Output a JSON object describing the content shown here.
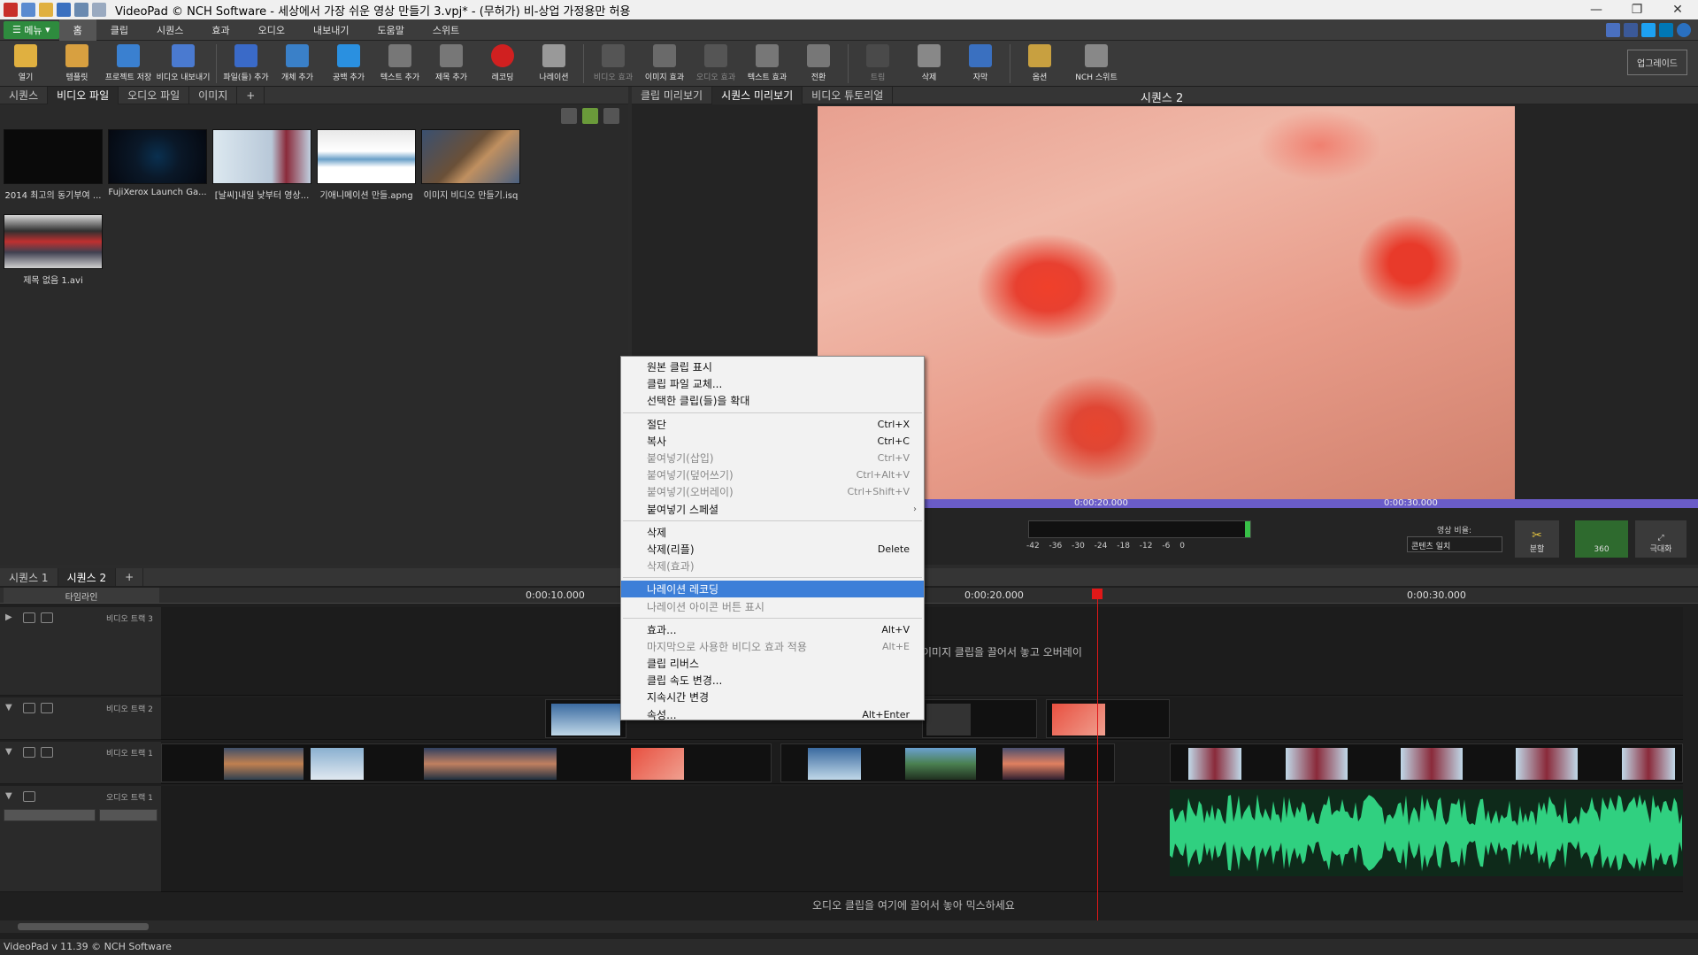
{
  "window": {
    "title": "VideoPad © NCH Software - 세상에서 가장 쉬운 영상 만들기 3.vpj* - (무허가) 비-상업 가정용만 허용"
  },
  "menu": {
    "main_button": "메뉴",
    "tabs": [
      "홈",
      "클립",
      "시퀀스",
      "효과",
      "오디오",
      "내보내기",
      "도움말",
      "스위트"
    ],
    "active_tab": "홈"
  },
  "ribbon": {
    "buttons": [
      "열기",
      "템플릿",
      "프로젝트 저장",
      "비디오 내보내기",
      "파일(들) 추가",
      "개체 추가",
      "공백 추가",
      "텍스트 추가",
      "제목 추가",
      "레코딩",
      "나레이션",
      "비디오 효과",
      "이미지 효과",
      "오디오 효과",
      "텍스트 효과",
      "전환",
      "트림",
      "삭제",
      "자막",
      "옵션",
      "NCH 스위트"
    ],
    "upgrade": "업그레이드"
  },
  "bin": {
    "tabs": [
      "시퀀스",
      "비디오 파일",
      "오디오 파일",
      "이미지",
      "+"
    ],
    "active_tab": "비디오 파일",
    "files": [
      {
        "name": "2014 최고의 동기부여 ..."
      },
      {
        "name": "FujiXerox Launch Ga..."
      },
      {
        "name": "[날씨]내일 낮부터 영상..."
      },
      {
        "name": "기애니메이션 만들.apng"
      },
      {
        "name": "이미지 비디오 만들기.isq"
      },
      {
        "name": "제목 없음 1.avi"
      }
    ]
  },
  "preview": {
    "tabs": [
      "클립 미리보기",
      "시퀀스 미리보기",
      "비디오 튜토리얼"
    ],
    "active_tab": "시퀀스 미리보기",
    "sequence_name": "시퀀스 2",
    "times": [
      "0:00:20.000",
      "0:00:30.000"
    ],
    "meter_scale": "-42 -36 -30 -24 -18 -12 -6 0",
    "ratio_label": "영상 비율:",
    "ratio_value": "콘텐츠 일치",
    "btn_split": "분할",
    "btn_360": "360",
    "btn_max": "극대화"
  },
  "timeline": {
    "tabs": [
      "시퀀스 1",
      "시퀀스 2",
      "+"
    ],
    "active_tab": "시퀀스 2",
    "ruler_label": "타임라인",
    "ticks": [
      "0:00:10.000",
      "0:00:20.000",
      "0:00:30.000"
    ],
    "tracks": [
      "비디오 트랙 3",
      "비디오 트랙 2",
      "비디오 트랙 1",
      "오디오 트랙 1"
    ],
    "overlay_hint": "이미지 클립을 끌어서 놓고 오버레이",
    "audio_hint": "오디오 클립을 여기에 끌어서 놓아 믹스하세요"
  },
  "status": {
    "text": "VideoPad v 11.39 © NCH Software"
  },
  "context_menu": {
    "groups": [
      [
        {
          "label": "원본 클립 표시",
          "shortcut": "",
          "disabled": false
        },
        {
          "label": "클립 파일 교체...",
          "shortcut": "",
          "disabled": false
        },
        {
          "label": "선택한 클립(들)을 확대",
          "shortcut": "",
          "disabled": false
        }
      ],
      [
        {
          "label": "절단",
          "shortcut": "Ctrl+X",
          "disabled": false
        },
        {
          "label": "복사",
          "shortcut": "Ctrl+C",
          "disabled": false
        },
        {
          "label": "붙여넣기(삽입)",
          "shortcut": "Ctrl+V",
          "disabled": true
        },
        {
          "label": "붙여넣기(덮어쓰기)",
          "shortcut": "Ctrl+Alt+V",
          "disabled": true
        },
        {
          "label": "붙여넣기(오버레이)",
          "shortcut": "Ctrl+Shift+V",
          "disabled": true
        },
        {
          "label": "붙여넣기 스페셜",
          "shortcut": "",
          "disabled": false,
          "submenu": true
        }
      ],
      [
        {
          "label": "삭제",
          "shortcut": "",
          "disabled": false
        },
        {
          "label": "삭제(리플)",
          "shortcut": "Delete",
          "disabled": false
        },
        {
          "label": "삭제(효과)",
          "shortcut": "",
          "disabled": true
        }
      ],
      [
        {
          "label": "나레이션 레코딩",
          "shortcut": "",
          "disabled": false,
          "highlighted": true
        },
        {
          "label": "나레이션 아이콘 버튼 표시",
          "shortcut": "",
          "disabled": true
        }
      ],
      [
        {
          "label": "효과...",
          "shortcut": "Alt+V",
          "disabled": false
        },
        {
          "label": "마지막으로 사용한 비디오 효과 적용",
          "shortcut": "Alt+E",
          "disabled": true
        },
        {
          "label": "클립 리버스",
          "shortcut": "",
          "disabled": false
        },
        {
          "label": "클립 속도 변경...",
          "shortcut": "",
          "disabled": false
        },
        {
          "label": "지속시간 변경",
          "shortcut": "",
          "disabled": false
        },
        {
          "label": "속성...",
          "shortcut": "Alt+Enter",
          "disabled": false
        }
      ]
    ]
  },
  "colors": {
    "accent_green": "#2e8b3e",
    "scrub_purple": "#6a5cc8",
    "playhead_red": "#e01818",
    "menu_highlight": "#3d7fd8",
    "waveform_green": "#30d080"
  }
}
